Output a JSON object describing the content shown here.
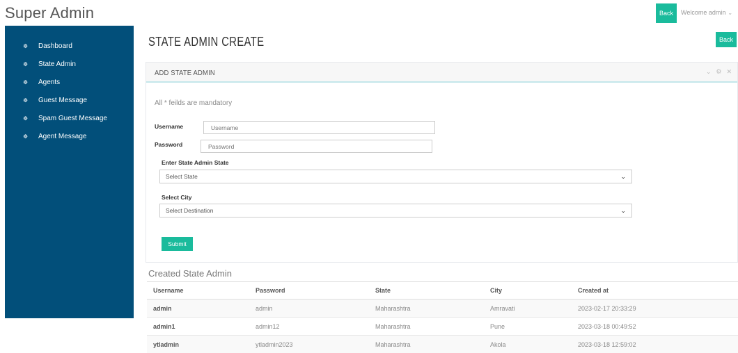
{
  "app": {
    "brand": "Super Admin"
  },
  "header": {
    "back_label": "Back",
    "welcome_text": "Welcome admin",
    "welcome_caret": "⌄"
  },
  "sidebar": {
    "icon": "☸",
    "items": [
      {
        "label": "Dashboard"
      },
      {
        "label": "State Admin"
      },
      {
        "label": "Agents"
      },
      {
        "label": "Guest Message"
      },
      {
        "label": "Spam Guest Message"
      },
      {
        "label": "Agent Message"
      }
    ]
  },
  "page": {
    "title": "STATE ADMIN CREATE",
    "back_label": "Back"
  },
  "panel": {
    "title": "ADD STATE ADMIN",
    "tools": [
      "⌄",
      "⚙",
      "✕"
    ]
  },
  "form": {
    "mandatory_note": "All * feilds are mandatory",
    "username_label": "Username",
    "username_placeholder": "Username",
    "password_label": "Password",
    "password_placeholder": "Password",
    "state_label": "Enter State Admin State",
    "state_selected": "Select State",
    "city_label": "Select City",
    "city_selected": "Select Destination",
    "submit_label": "Submit"
  },
  "table": {
    "title": "Created State Admin",
    "columns": [
      "Username",
      "Password",
      "State",
      "City",
      "Created at"
    ],
    "rows": [
      [
        "admin",
        "admin",
        "Maharashtra",
        "Amravati",
        "2023-02-17 20:33:29"
      ],
      [
        "admin1",
        "admin12",
        "Maharashtra",
        "Pune",
        "2023-03-18 00:49:52"
      ],
      [
        "ytladmin",
        "ytladmin2023",
        "Maharashtra",
        "Akola",
        "2023-03-18 12:59:02"
      ]
    ]
  },
  "colors": {
    "accent": "#1abb9c",
    "sidebar": "#024f7a"
  }
}
